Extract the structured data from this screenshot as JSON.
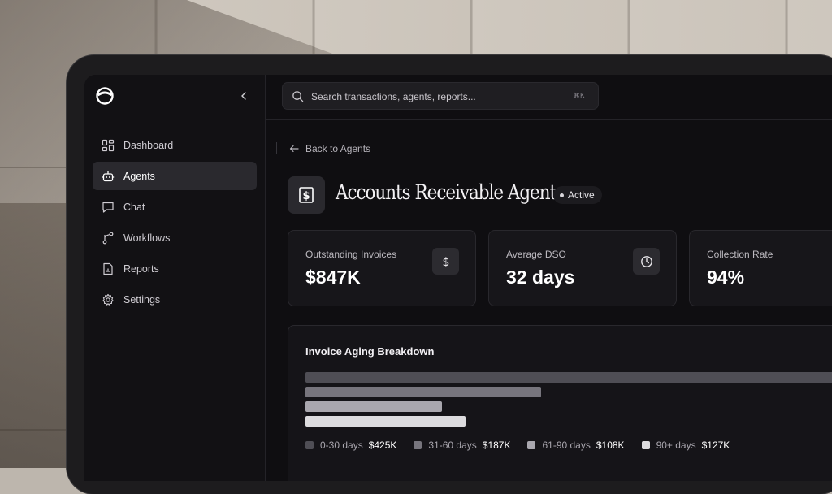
{
  "search": {
    "placeholder": "Search transactions, agents, reports...",
    "shortcut": "⌘K"
  },
  "sidebar": {
    "items": [
      {
        "label": "Dashboard",
        "icon": "dashboard-icon",
        "active": false
      },
      {
        "label": "Agents",
        "icon": "bot-icon",
        "active": true
      },
      {
        "label": "Chat",
        "icon": "chat-icon",
        "active": false
      },
      {
        "label": "Workflows",
        "icon": "workflow-icon",
        "active": false
      },
      {
        "label": "Reports",
        "icon": "report-icon",
        "active": false
      },
      {
        "label": "Settings",
        "icon": "gear-icon",
        "active": false
      }
    ]
  },
  "header": {
    "back_label": "Back to Agents",
    "title": "Accounts Receivable Agent",
    "status": "Active"
  },
  "metrics": [
    {
      "label": "Outstanding Invoices",
      "value": "$847K",
      "icon": "dollar-icon"
    },
    {
      "label": "Average DSO",
      "value": "32 days",
      "icon": "clock-icon"
    },
    {
      "label": "Collection Rate",
      "value": "94%"
    }
  ],
  "aging": {
    "title": "Invoice Aging Breakdown",
    "buckets": [
      {
        "name": "0-30 days",
        "amount": "$425K",
        "color": "#4f4e55"
      },
      {
        "name": "31-60 days",
        "amount": "$187K",
        "color": "#77757d"
      },
      {
        "name": "61-90 days",
        "amount": "$108K",
        "color": "#a9a7ae"
      },
      {
        "name": "90+ days",
        "amount": "$127K",
        "color": "#dcdbde"
      }
    ]
  },
  "chart_data": {
    "type": "bar",
    "categories": [
      "0-30 days",
      "31-60 days",
      "61-90 days",
      "90+ days"
    ],
    "values": [
      425,
      187,
      108,
      127
    ],
    "title": "Invoice Aging Breakdown",
    "xlabel": "",
    "ylabel": ""
  }
}
